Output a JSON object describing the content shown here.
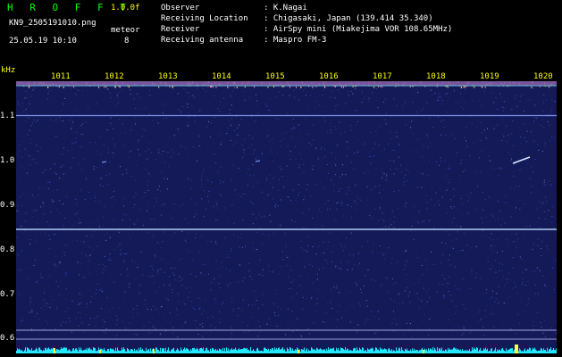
{
  "header": {
    "app_title": "H R O F F T",
    "version": "1.0.0f",
    "filename": "KN9_2505191010.png",
    "meteor_label": "meteor",
    "meteor_count": "8",
    "datetime": "25.05.19 10:10"
  },
  "info": [
    {
      "label": "Observer",
      "value": ": K.Nagai"
    },
    {
      "label": "Receiving Location",
      "value": ": Chigasaki, Japan (139.414 35.340)"
    },
    {
      "label": "Receiver",
      "value": ": AirSpy mini (Miakejima VOR 108.65MHz)"
    },
    {
      "label": "Receiving antenna",
      "value": ": Maspro FM-3"
    }
  ],
  "axis": {
    "y_unit": "kHz",
    "y_ticks": [
      "1.1",
      "1.0",
      "0.9",
      "0.8",
      "0.7",
      "0.6"
    ],
    "x_ticks": [
      "1011",
      "1012",
      "1013",
      "1014",
      "1015",
      "1016",
      "1017",
      "1018",
      "1019",
      "1020"
    ]
  },
  "colors": {
    "background": "#000000",
    "spectrogram_bg": "#141a58",
    "title": "#00ff00",
    "labels": "#ffff00",
    "text": "#ffffff"
  }
}
